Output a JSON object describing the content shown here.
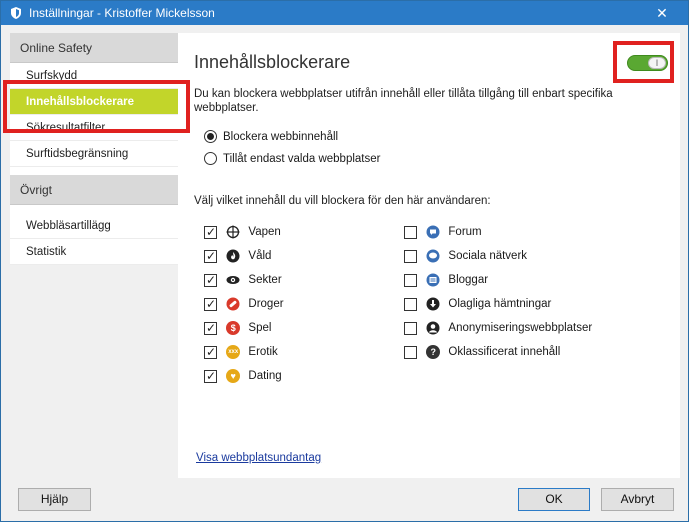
{
  "window": {
    "title": "Inställningar - Kristoffer Mickelsson",
    "close": "✕"
  },
  "sidebar": {
    "group1": "Online Safety",
    "items1": [
      "Surfskydd",
      "Innehållsblockerare",
      "Sökresultatfilter",
      "Surftidsbegränsning"
    ],
    "group2": "Övrigt",
    "items2": [
      "Webbläsartillägg",
      "Statistik"
    ]
  },
  "main": {
    "title": "Innehållsblockerare",
    "toggle_glyph": "I",
    "description": "Du kan blockera webbplatser utifrån innehåll eller tillåta tillgång till enbart specifika webbplatser.",
    "radio_block": "Blockera webbinnehåll",
    "radio_allow": "Tillåt endast valda webbplatser",
    "categories_label": "Välj vilket innehåll du vill blockera för den här användaren:",
    "left_categories": [
      "Vapen",
      "Våld",
      "Sekter",
      "Droger",
      "Spel",
      "Erotik",
      "Dating"
    ],
    "right_categories": [
      "Forum",
      "Sociala nätverk",
      "Bloggar",
      "Olagliga hämtningar",
      "Anonymiseringswebbplatser",
      "Oklassificerat innehåll"
    ],
    "exceptions_link": "Visa webbplatsundantag"
  },
  "footer": {
    "help": "Hjälp",
    "ok": "OK",
    "cancel": "Avbryt"
  },
  "colors": {
    "titlebar": "#2b7bc7",
    "active": "#c2d52a",
    "toggle_on": "#5aa832",
    "highlight": "#e0211f"
  }
}
